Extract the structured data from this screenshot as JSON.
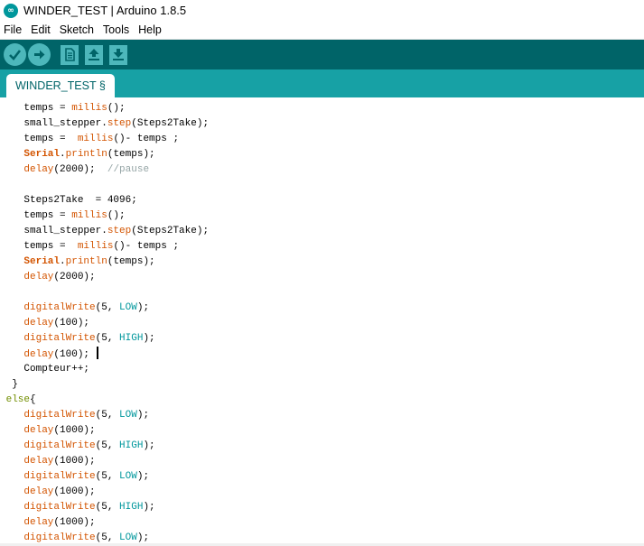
{
  "window": {
    "title": "WINDER_TEST | Arduino 1.8.5",
    "logo_text": "∞"
  },
  "menu": [
    "File",
    "Edit",
    "Sketch",
    "Tools",
    "Help"
  ],
  "toolbar": {
    "verify": "verify-icon",
    "upload": "upload-arrow-icon",
    "new": "new-file-icon",
    "open": "open-arrow-up-icon",
    "save": "save-arrow-down-icon"
  },
  "tab": {
    "label": "WINDER_TEST §"
  },
  "colors": {
    "toolbar_bg": "#006468",
    "tabbar_bg": "#17a1a5",
    "button_bg": "#4db7bb",
    "function": "#d35400",
    "constant": "#00979c",
    "comment": "#95a5a6",
    "control": "#728e00"
  },
  "code": [
    [
      {
        "t": "    temps = "
      },
      {
        "t": "millis",
        "c": "fn"
      },
      {
        "t": "();"
      }
    ],
    [
      {
        "t": "    small_stepper."
      },
      {
        "t": "step",
        "c": "fn"
      },
      {
        "t": "(Steps2Take);"
      }
    ],
    [
      {
        "t": "    temps =  "
      },
      {
        "t": "millis",
        "c": "fn"
      },
      {
        "t": "()- temps ;"
      }
    ],
    [
      {
        "t": "    "
      },
      {
        "t": "Serial",
        "c": "serial"
      },
      {
        "t": "."
      },
      {
        "t": "println",
        "c": "fn"
      },
      {
        "t": "(temps);"
      }
    ],
    [
      {
        "t": "    "
      },
      {
        "t": "delay",
        "c": "fn"
      },
      {
        "t": "(2000);  "
      },
      {
        "t": "//pause",
        "c": "comment"
      }
    ],
    [
      {
        "t": ""
      }
    ],
    [
      {
        "t": "    Steps2Take  = 4096;"
      }
    ],
    [
      {
        "t": "    temps = "
      },
      {
        "t": "millis",
        "c": "fn"
      },
      {
        "t": "();"
      }
    ],
    [
      {
        "t": "    small_stepper."
      },
      {
        "t": "step",
        "c": "fn"
      },
      {
        "t": "(Steps2Take);"
      }
    ],
    [
      {
        "t": "    temps =  "
      },
      {
        "t": "millis",
        "c": "fn"
      },
      {
        "t": "()- temps ;"
      }
    ],
    [
      {
        "t": "    "
      },
      {
        "t": "Serial",
        "c": "serial"
      },
      {
        "t": "."
      },
      {
        "t": "println",
        "c": "fn"
      },
      {
        "t": "(temps);"
      }
    ],
    [
      {
        "t": "    "
      },
      {
        "t": "delay",
        "c": "fn"
      },
      {
        "t": "(2000);"
      }
    ],
    [
      {
        "t": ""
      }
    ],
    [
      {
        "t": "    "
      },
      {
        "t": "digitalWrite",
        "c": "fn"
      },
      {
        "t": "(5, "
      },
      {
        "t": "LOW",
        "c": "const"
      },
      {
        "t": ");"
      }
    ],
    [
      {
        "t": "    "
      },
      {
        "t": "delay",
        "c": "fn"
      },
      {
        "t": "(100);"
      }
    ],
    [
      {
        "t": "    "
      },
      {
        "t": "digitalWrite",
        "c": "fn"
      },
      {
        "t": "(5, "
      },
      {
        "t": "HIGH",
        "c": "const"
      },
      {
        "t": ");"
      }
    ],
    [
      {
        "t": "    "
      },
      {
        "t": "delay",
        "c": "fn"
      },
      {
        "t": "(100); "
      },
      {
        "t": "",
        "c": "caret"
      }
    ],
    [
      {
        "t": "    Compteur++;"
      }
    ],
    [
      {
        "t": "  }"
      }
    ],
    [
      {
        "t": " "
      },
      {
        "t": "else",
        "c": "ctrl"
      },
      {
        "t": "{"
      }
    ],
    [
      {
        "t": "    "
      },
      {
        "t": "digitalWrite",
        "c": "fn"
      },
      {
        "t": "(5, "
      },
      {
        "t": "LOW",
        "c": "const"
      },
      {
        "t": ");"
      }
    ],
    [
      {
        "t": "    "
      },
      {
        "t": "delay",
        "c": "fn"
      },
      {
        "t": "(1000);"
      }
    ],
    [
      {
        "t": "    "
      },
      {
        "t": "digitalWrite",
        "c": "fn"
      },
      {
        "t": "(5, "
      },
      {
        "t": "HIGH",
        "c": "const"
      },
      {
        "t": ");"
      }
    ],
    [
      {
        "t": "    "
      },
      {
        "t": "delay",
        "c": "fn"
      },
      {
        "t": "(1000);"
      }
    ],
    [
      {
        "t": "    "
      },
      {
        "t": "digitalWrite",
        "c": "fn"
      },
      {
        "t": "(5, "
      },
      {
        "t": "LOW",
        "c": "const"
      },
      {
        "t": ");"
      }
    ],
    [
      {
        "t": "    "
      },
      {
        "t": "delay",
        "c": "fn"
      },
      {
        "t": "(1000);"
      }
    ],
    [
      {
        "t": "    "
      },
      {
        "t": "digitalWrite",
        "c": "fn"
      },
      {
        "t": "(5, "
      },
      {
        "t": "HIGH",
        "c": "const"
      },
      {
        "t": ");"
      }
    ],
    [
      {
        "t": "    "
      },
      {
        "t": "delay",
        "c": "fn"
      },
      {
        "t": "(1000);"
      }
    ],
    [
      {
        "t": "    "
      },
      {
        "t": "digitalWrite",
        "c": "fn"
      },
      {
        "t": "(5, "
      },
      {
        "t": "LOW",
        "c": "const"
      },
      {
        "t": ");"
      }
    ]
  ]
}
